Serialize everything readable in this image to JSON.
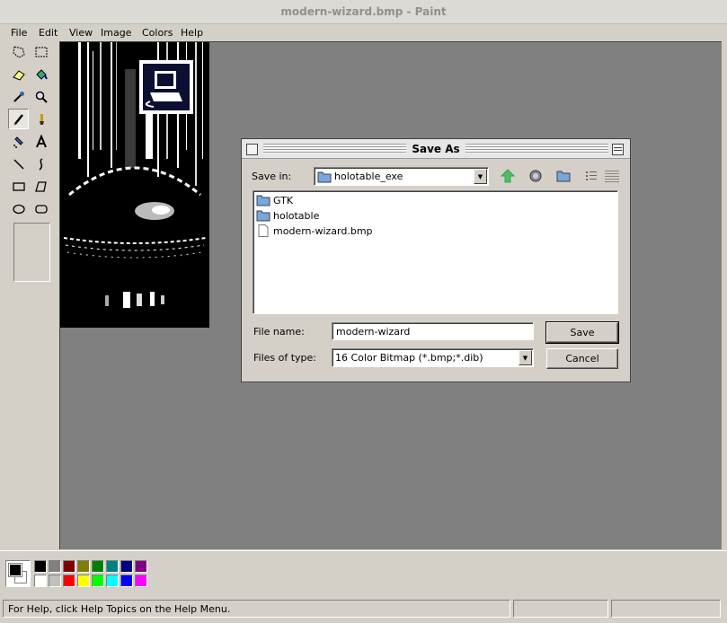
{
  "window": {
    "title": "modern-wizard.bmp - Paint"
  },
  "menu": [
    {
      "label": "File"
    },
    {
      "label": "Edit"
    },
    {
      "label": "View"
    },
    {
      "label": "Image"
    },
    {
      "label": "Colors"
    },
    {
      "label": "Help"
    }
  ],
  "tools": [
    "free-form-select-icon",
    "rectangle-select-icon",
    "eraser-icon",
    "fill-bucket-icon",
    "color-picker-icon",
    "magnifier-icon",
    "pencil-icon",
    "brush-icon",
    "airbrush-icon",
    "text-icon",
    "line-icon",
    "curve-icon",
    "rectangle-icon",
    "polygon-icon",
    "ellipse-icon",
    "rounded-rectangle-icon"
  ],
  "palette": {
    "foreground": "#000000",
    "background": "#ffffff",
    "row1": [
      "#000000",
      "#808080",
      "#800000",
      "#808000",
      "#008000",
      "#008080",
      "#000080",
      "#800080"
    ],
    "row2": [
      "#ffffff",
      "#c0c0c0",
      "#ff0000",
      "#ffff00",
      "#00ff00",
      "#00ffff",
      "#0000ff",
      "#ff00ff"
    ]
  },
  "status": {
    "text": "For Help, click Help Topics on the Help Menu."
  },
  "dialog": {
    "title": "Save As",
    "save_in_label": "Save in:",
    "save_in_value": "holotable_exe",
    "files": [
      {
        "name": "GTK",
        "type": "folder"
      },
      {
        "name": "holotable",
        "type": "folder"
      },
      {
        "name": "modern-wizard.bmp",
        "type": "file"
      }
    ],
    "filename_label": "File name:",
    "filename_value": "modern-wizard",
    "filetype_label": "Files of type:",
    "filetype_value": "16 Color Bitmap (*.bmp;*.dib)",
    "save_button": "Save",
    "cancel_button": "Cancel"
  }
}
